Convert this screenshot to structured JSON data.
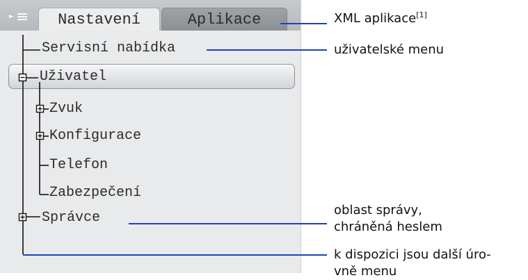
{
  "tabs": [
    {
      "label": "Nastavení",
      "active": true
    },
    {
      "label": "Aplikace",
      "active": false
    }
  ],
  "tree": {
    "root": "Servisní nabídka",
    "user": "Uživatel",
    "sound": "Zvuk",
    "config": "Konfigurace",
    "phone": "Telefon",
    "security": "Zabezpečení",
    "admin": "Správce"
  },
  "callouts": {
    "xml_text": "XML aplikace",
    "xml_ref": "[1]",
    "user_menu": "uživatelské menu",
    "admin_line1": "oblast správy,",
    "admin_line2": "chráněná heslem",
    "more_line1": "k dispozici jsou další úro-",
    "more_line2": "vně menu"
  },
  "colors": {
    "leader": "#1f3fbf",
    "tree_line": "#111111",
    "tabbar": "#b8bbbf"
  },
  "icons": {
    "menu": "menu-icon",
    "expand": "plus-box-icon"
  }
}
